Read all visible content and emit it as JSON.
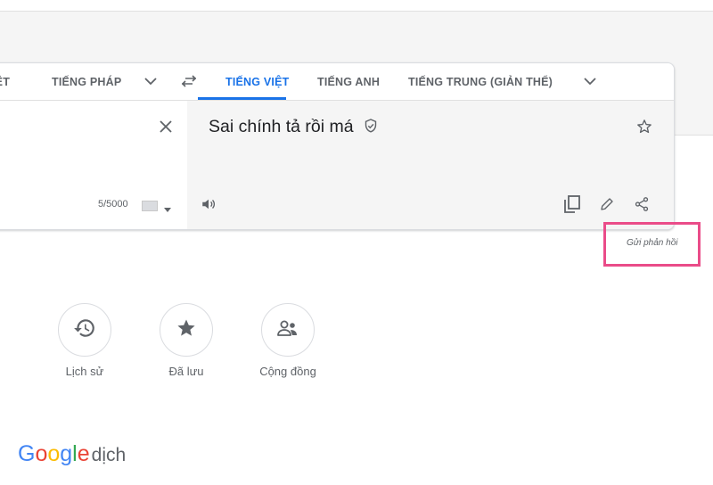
{
  "source_languages": [
    "IỆT",
    "TIẾNG PHÁP"
  ],
  "target_languages": [
    "TIẾNG VIỆT",
    "TIẾNG ANH",
    "TIẾNG TRUNG (GIẢN THỂ)"
  ],
  "translation": {
    "text": "Sai chính tả rồi má"
  },
  "source": {
    "char_count": "5/5000"
  },
  "feedback": {
    "label": "Gửi phản hồi"
  },
  "shortcuts": [
    {
      "label": "Lịch sử",
      "icon": "history-icon"
    },
    {
      "label": "Đã lưu",
      "icon": "star-icon"
    },
    {
      "label": "Cộng đồng",
      "icon": "community-icon"
    }
  ],
  "logo": {
    "brand": "Google",
    "suffix": "dịch"
  },
  "colors": {
    "accent": "#1a73e8",
    "highlight": "#ea4c89"
  }
}
